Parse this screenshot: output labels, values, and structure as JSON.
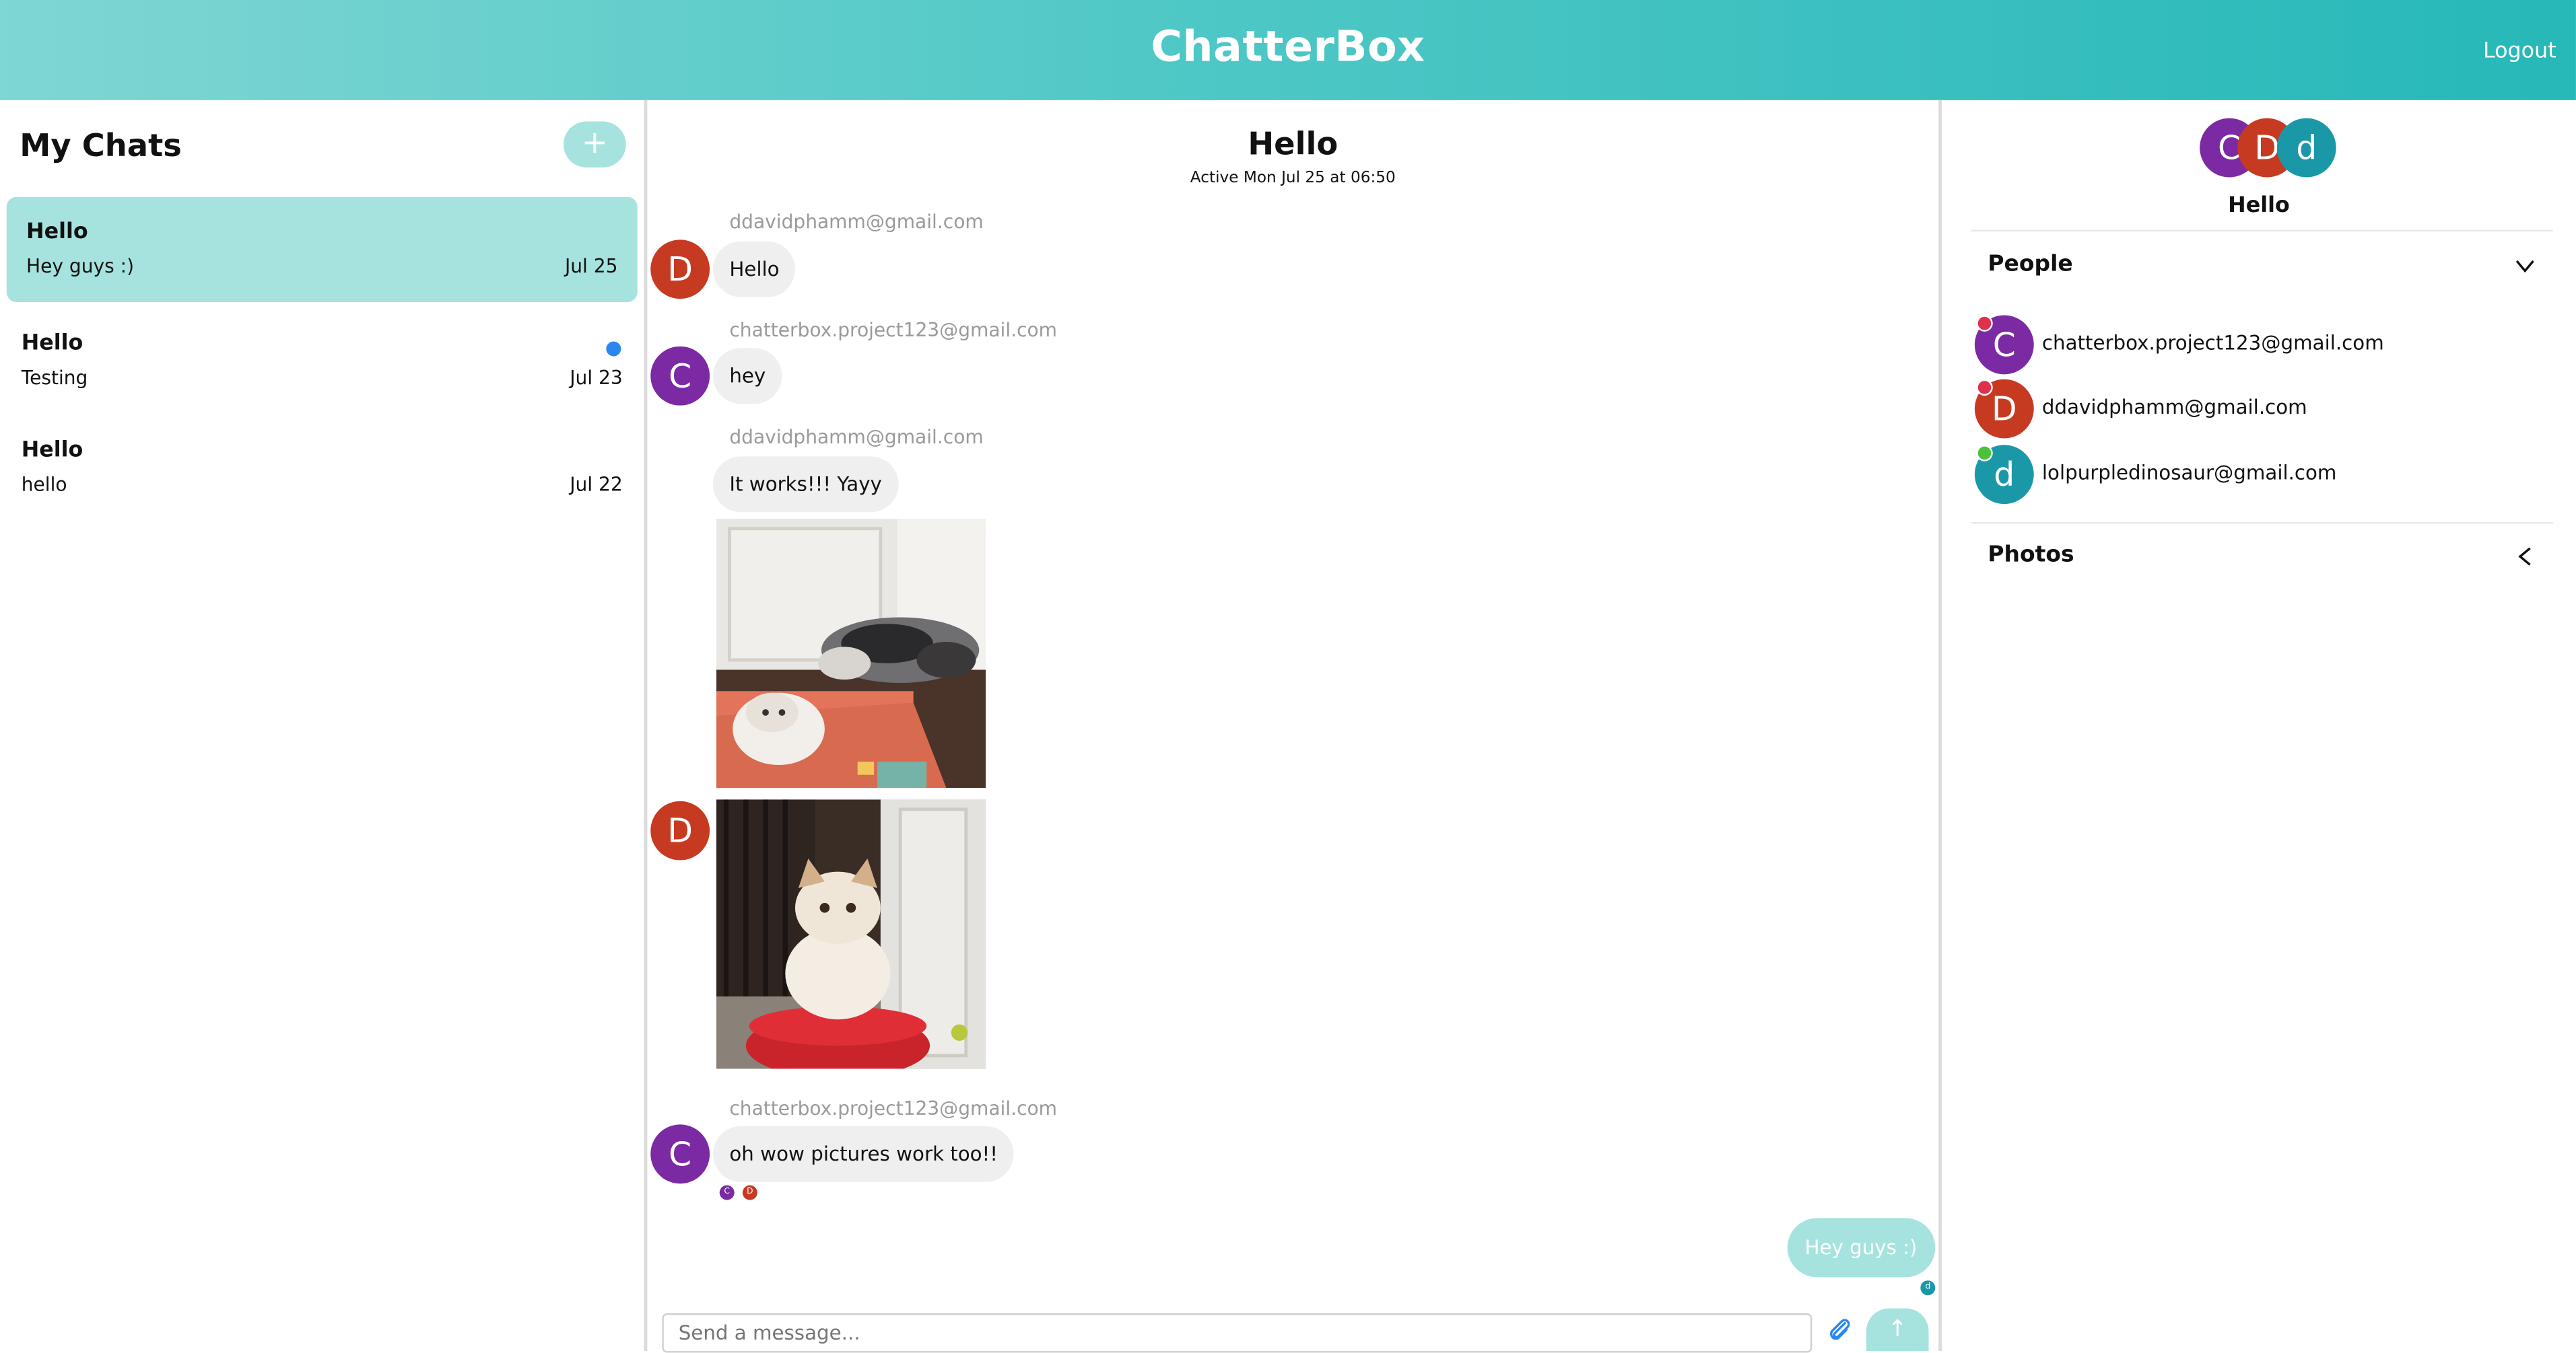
{
  "app": {
    "title": "ChatterBox",
    "logout_label": "Logout"
  },
  "sidebar": {
    "heading": "My Chats",
    "new_chat_label": "+",
    "chats": [
      {
        "title": "Hello",
        "preview": "Hey guys :)",
        "date": "Jul 25",
        "active": true
      },
      {
        "title": "Hello",
        "preview": "Testing",
        "date": "Jul 23",
        "unread": true
      },
      {
        "title": "Hello",
        "preview": "hello",
        "date": "Jul 22"
      }
    ]
  },
  "conversation": {
    "title": "Hello",
    "active_status": "Active Mon Jul 25 at 06:50",
    "messages": [
      {
        "sender": "ddavidphamm@gmail.com",
        "avatar_letter": "D",
        "text": "Hello"
      },
      {
        "sender": "chatterbox.project123@gmail.com",
        "avatar_letter": "C",
        "text": "hey"
      },
      {
        "sender": "ddavidphamm@gmail.com",
        "avatar_letter": "D",
        "text": "It works!!! Yayy",
        "photos": [
          "dog and cat photo",
          "cat on stool photo"
        ]
      },
      {
        "sender": "chatterbox.project123@gmail.com",
        "avatar_letter": "C",
        "text": "oh wow pictures work too!!",
        "read_receipts": [
          "C",
          "D"
        ]
      }
    ],
    "own_message": {
      "text": "Hey guys :)",
      "read_receipts": [
        "d"
      ]
    },
    "composer_placeholder": "Send a message...",
    "send_label": "↑"
  },
  "details": {
    "avatars": [
      "C",
      "D",
      "d"
    ],
    "name": "Hello",
    "people_heading": "People",
    "people": [
      {
        "email": "chatterbox.project123@gmail.com",
        "letter": "C",
        "status": "offline"
      },
      {
        "email": "ddavidphamm@gmail.com",
        "letter": "D",
        "status": "offline"
      },
      {
        "email": "lolpurpledinosaur@gmail.com",
        "letter": "d",
        "status": "online"
      }
    ],
    "photos_heading": "Photos"
  },
  "colors": {
    "accent": "#a6e3de",
    "header_start": "#7fd6d3",
    "header_end": "#27b8b8",
    "avatar_c": "#7b2aa3",
    "avatar_d": "#c73a22",
    "avatar_lower_d": "#1b98a8",
    "status_offline": "#e0314c",
    "status_online": "#4cc23a",
    "unread": "#2b86f0"
  }
}
